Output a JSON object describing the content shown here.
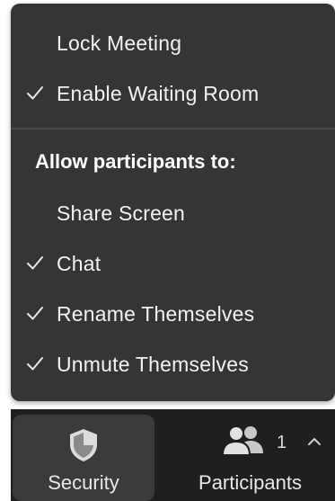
{
  "menu": {
    "items": [
      {
        "label": "Lock Meeting",
        "checked": false
      },
      {
        "label": "Enable Waiting Room",
        "checked": true
      }
    ],
    "section_heading": "Allow participants to:",
    "permissions": [
      {
        "label": "Share Screen",
        "checked": false
      },
      {
        "label": "Chat",
        "checked": true
      },
      {
        "label": "Rename Themselves",
        "checked": true
      },
      {
        "label": "Unmute Themselves",
        "checked": true
      }
    ]
  },
  "toolbar": {
    "security_label": "Security",
    "security_icon": "shield-icon",
    "participants_label": "Participants",
    "participants_icon": "participants-icon",
    "participants_count": "1",
    "expand_icon": "chevron-up-icon"
  },
  "colors": {
    "menu_bg": "#353535",
    "toolbar_bg": "#1f1f1f",
    "active_tool_bg": "#3b3b3b",
    "text": "#f2f2f2"
  }
}
